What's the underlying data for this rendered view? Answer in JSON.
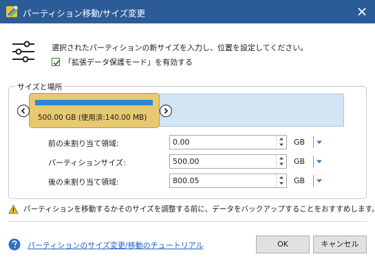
{
  "window": {
    "title": "パーティション移動/サイズ変更",
    "close_icon": "close-icon",
    "app_icon": "partition-wizard-icon"
  },
  "header": {
    "instruction": "選択されたパーティションの新サイズを入力し、位置を設定してください。",
    "protect_mode_label": "「拡張データ保護モード」を有効する",
    "protect_mode_checked": true
  },
  "group": {
    "legend": "サイズと場所"
  },
  "partition": {
    "label": "500.00 GB (使用済:140.00 MB)",
    "used_fraction": 0.95,
    "block_color": "#e8c971",
    "fill_color": "#2a86d6",
    "disk_color": "#d3e5f4"
  },
  "fields": [
    {
      "label": "前の未割り当て領域:",
      "value": "0.00",
      "unit": "GB"
    },
    {
      "label": "パーティションサイズ:",
      "value": "500.00",
      "unit": "GB"
    },
    {
      "label": "後の未割り当て領域:",
      "value": "800.05",
      "unit": "GB"
    }
  ],
  "warning": {
    "text": "パーティションを移動するかそのサイズを調整する前に、データをバックアップすることをおすすめします。"
  },
  "footer": {
    "help_link": "パーティションのサイズ変更/移動のチュートリアル",
    "ok_label": "OK",
    "cancel_label": "キャンセル"
  },
  "colors": {
    "titlebar": "#2c5c97",
    "link": "#1f5fbf"
  }
}
